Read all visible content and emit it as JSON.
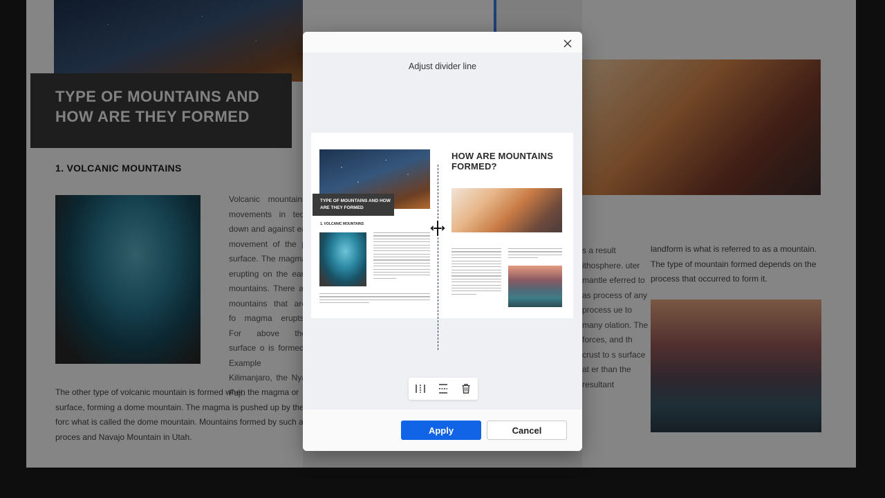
{
  "background": {
    "title": "TYPE OF MOUNTAINS AND HOW ARE THEY FORMED",
    "section_heading": "1. VOLCANIC MOUNTAINS",
    "column_text": "Volcanic mountains movements in tect down and against ea movement of the p surface. The magma erupting on the eart mountains. There ar mountains that are fo magma erupts. For above the surface o is formed. Example Kilimanjaro, the Nya Fuji.",
    "paragraph": "The other type of volcanic mountain is formed when the magma or surface, forming a dome mountain. The magma is pushed up by the forc what is called the dome mountain. Mountains formed by such a proces and Navajo Mountain in Utah.",
    "right_column_partial": "s a result ithosphere. uter mantle eferred to as process of any process ue to many olation. The forces, and th crust to s surface at er than the resultant",
    "right_paragraph": "landform is what is referred to as a mountain. The type of mountain formed depends on the process that occurred to form it."
  },
  "dialog": {
    "title": "Adjust divider line",
    "close_icon": "close-icon",
    "preview": {
      "left_title": "TYPE OF MOUNTAINS AND HOW ARE THEY FORMED",
      "left_heading": "1. VOLCANIC MOUNTAINS",
      "right_title": "HOW ARE MOUNTAINS FORMED?"
    },
    "toolbar": {
      "vertical_divider_icon": "vertical-divider-icon",
      "horizontal_divider_icon": "horizontal-divider-icon",
      "delete_icon": "trash-icon"
    },
    "apply_label": "Apply",
    "cancel_label": "Cancel"
  },
  "colors": {
    "accent": "#1264e6",
    "divider": "#1a3a7a",
    "dialog_bg": "#eef0f3"
  }
}
